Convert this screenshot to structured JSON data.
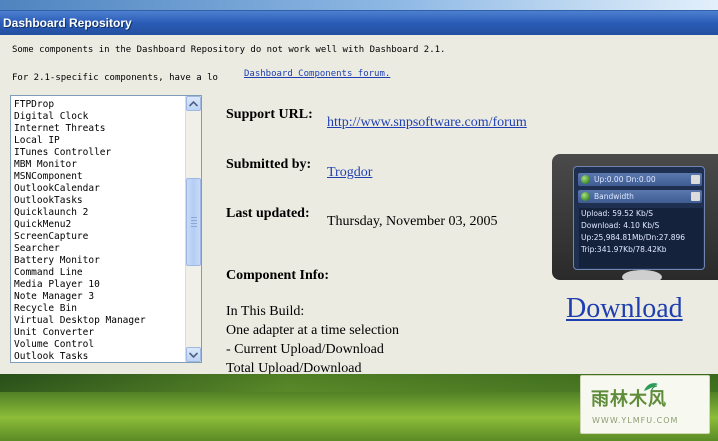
{
  "window": {
    "title": "Dashboard Repository"
  },
  "notice": {
    "line1": "Some components in the Dashboard Repository do not work well with Dashboard 2.1.",
    "line2_prefix": "For 2.1-specific components, have a lo",
    "forum_link": "Dashboard Components forum."
  },
  "component_list": {
    "items": [
      "FTPDrop",
      "Digital Clock",
      "Internet Threats",
      "Local IP",
      "ITunes Controller",
      "MBM Monitor",
      "MSNComponent",
      "OutlookCalendar",
      "OutlookTasks",
      "Quicklaunch 2",
      "QuickMenu2",
      "ScreenCapture",
      "Searcher",
      "Battery Monitor",
      "Command Line",
      "Media Player 10",
      "Note Manager 3",
      "Recycle Bin",
      "Virtual Desktop Manager",
      "Unit Converter",
      "Volume Control",
      "Outlook Tasks"
    ]
  },
  "details": {
    "support_url_label": "Support URL:",
    "support_url_value": "http://www.snpsoftware.com/forum",
    "submitted_by_label": "Submitted by:",
    "submitted_by_value": "Trogdor",
    "last_updated_label": "Last updated:",
    "last_updated_value": "Thursday, November 03, 2005",
    "component_info_label": "Component Info:",
    "build_lines": [
      "In This Build:",
      "One adapter at a time selection",
      "- Current Upload/Download",
      "Total Upload/Download"
    ]
  },
  "preview": {
    "row1": "Up:0.00 Dn:0.00",
    "row2": "Bandwidth",
    "stats": [
      "Upload:       59.52 Kb/S",
      "Download:    4.10 Kb/S",
      "Up:25,984.81Mb/Dn:27.896",
      "Trip:341.97Kb/78.42Kb"
    ]
  },
  "download_label": "Download",
  "watermark": {
    "main": "雨林木风",
    "sub": "WWW.YLMFU.COM"
  },
  "colors": {
    "title_bar": "#2a5cb6",
    "link": "#1f3fb0",
    "window_bg": "#ecebe2"
  },
  "icons": {
    "scroll_up": "chevron-up-icon",
    "scroll_down": "chevron-down-icon",
    "globe": "network-globe-icon"
  }
}
